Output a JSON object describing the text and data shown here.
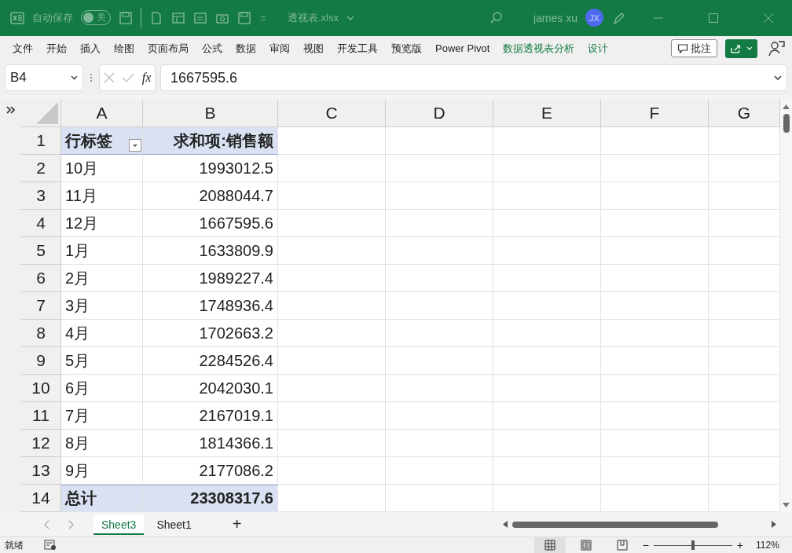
{
  "title_bar": {
    "autosave_label": "自动保存",
    "autosave": {
      "on": false,
      "label": "关"
    },
    "filename": "透视表.xlsx",
    "user": "james xu",
    "avatar": "JX"
  },
  "ribbon_tabs": [
    {
      "label": "文件",
      "contextual": false
    },
    {
      "label": "开始",
      "contextual": false
    },
    {
      "label": "插入",
      "contextual": false
    },
    {
      "label": "绘图",
      "contextual": false
    },
    {
      "label": "页面布局",
      "contextual": false
    },
    {
      "label": "公式",
      "contextual": false
    },
    {
      "label": "数据",
      "contextual": false
    },
    {
      "label": "审阅",
      "contextual": false
    },
    {
      "label": "视图",
      "contextual": false
    },
    {
      "label": "开发工具",
      "contextual": false
    },
    {
      "label": "预览版",
      "contextual": false
    },
    {
      "label": "Power Pivot",
      "contextual": false
    },
    {
      "label": "数据透视表分析",
      "contextual": true
    },
    {
      "label": "设计",
      "contextual": true
    }
  ],
  "comments_button": "批注",
  "formula_bar": {
    "name_box": "B4",
    "fx": "fx",
    "value": "1667595.6"
  },
  "grid": {
    "columns": [
      "A",
      "B",
      "C",
      "D",
      "E",
      "F",
      "G"
    ],
    "rows": [
      {
        "number": "1",
        "kind": "header",
        "cells": [
          "行标签",
          "求和项:销售额"
        ]
      },
      {
        "number": "2",
        "kind": "data",
        "cells": [
          "10月",
          "1993012.5"
        ]
      },
      {
        "number": "3",
        "kind": "data",
        "cells": [
          "11月",
          "2088044.7"
        ]
      },
      {
        "number": "4",
        "kind": "data",
        "cells": [
          "12月",
          "1667595.6"
        ]
      },
      {
        "number": "5",
        "kind": "data",
        "cells": [
          "1月",
          "1633809.9"
        ]
      },
      {
        "number": "6",
        "kind": "data",
        "cells": [
          "2月",
          "1989227.4"
        ]
      },
      {
        "number": "7",
        "kind": "data",
        "cells": [
          "3月",
          "1748936.4"
        ]
      },
      {
        "number": "8",
        "kind": "data",
        "cells": [
          "4月",
          "1702663.2"
        ]
      },
      {
        "number": "9",
        "kind": "data",
        "cells": [
          "5月",
          "2284526.4"
        ]
      },
      {
        "number": "10",
        "kind": "data",
        "cells": [
          "6月",
          "2042030.1"
        ]
      },
      {
        "number": "11",
        "kind": "data",
        "cells": [
          "7月",
          "2167019.1"
        ]
      },
      {
        "number": "12",
        "kind": "data",
        "cells": [
          "8月",
          "1814366.1"
        ]
      },
      {
        "number": "13",
        "kind": "data",
        "cells": [
          "9月",
          "2177086.2"
        ]
      },
      {
        "number": "14",
        "kind": "total",
        "cells": [
          "总计",
          "23308317.6"
        ]
      }
    ]
  },
  "sheet_tabs": [
    {
      "label": "Sheet3",
      "selected": true
    },
    {
      "label": "Sheet1",
      "selected": false
    }
  ],
  "add_sheet": "+",
  "status_bar": {
    "status": "就绪",
    "zoom_out": "−",
    "zoom_in": "+",
    "zoom": {
      "level": 0.5
    },
    "zoom_reading": "112%"
  }
}
